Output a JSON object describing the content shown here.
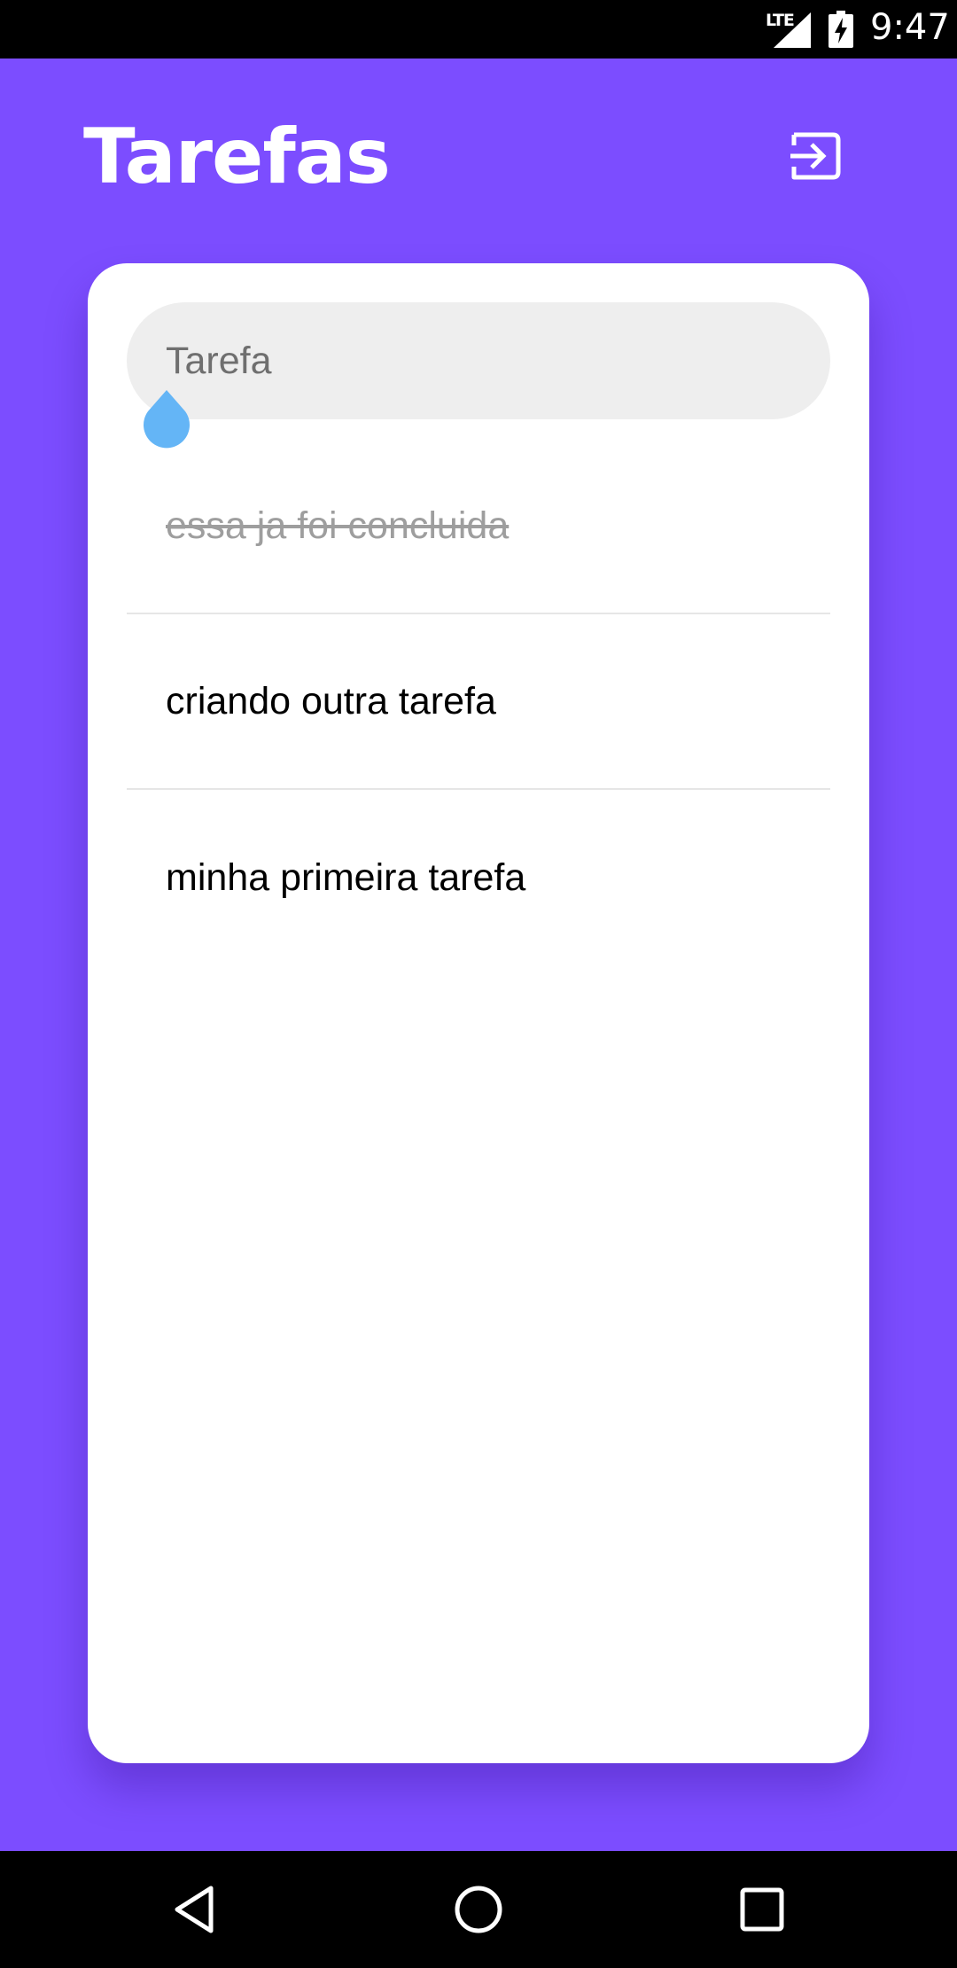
{
  "status_bar": {
    "network": "LTE",
    "time": "9:47",
    "icons": [
      "signal-icon",
      "battery-charging-icon"
    ]
  },
  "header": {
    "title": "Tarefas",
    "action_icon": "logout-icon"
  },
  "task_input": {
    "value": "",
    "placeholder": "Tarefa"
  },
  "tasks": [
    {
      "text": "essa ja foi concluida",
      "done": true
    },
    {
      "text": "criando outra tarefa",
      "done": false
    },
    {
      "text": "minha primeira tarefa",
      "done": false
    }
  ],
  "colors": {
    "primary": "#7c4dff",
    "card": "#ffffff",
    "input_background": "#eeeeee",
    "cursor_handle": "#64b5f6",
    "done_text": "#9e9e9e"
  },
  "nav_bar": {
    "icons": [
      "back-icon",
      "home-icon",
      "recents-icon"
    ]
  }
}
